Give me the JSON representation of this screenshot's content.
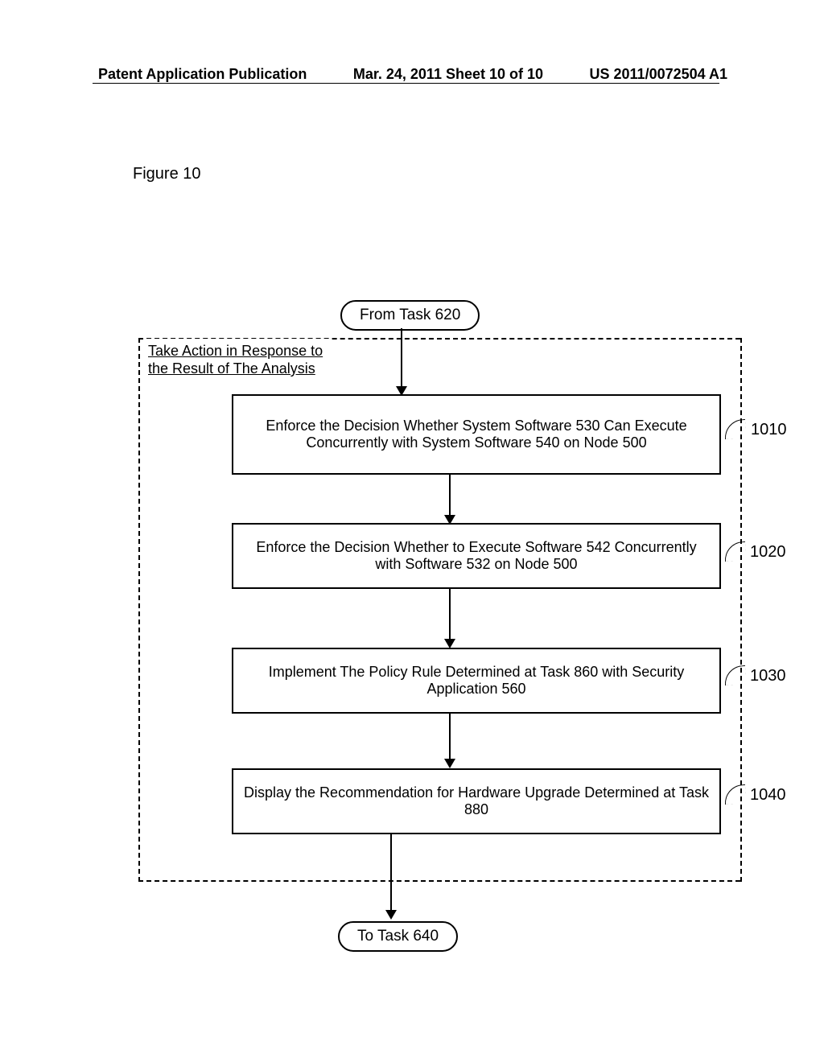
{
  "header": {
    "left": "Patent Application Publication",
    "center": "Mar. 24, 2011  Sheet 10 of 10",
    "right": "US 2011/0072504 A1"
  },
  "figure_label": "Figure 10",
  "terminals": {
    "from": "From Task 620",
    "to": "To Task 640"
  },
  "dashed_title_line1": "Take Action in Response to",
  "dashed_title_line2": "the Result of The Analysis",
  "boxes": {
    "b1": "Enforce the Decision Whether System Software 530 Can Execute Concurrently with System Software 540 on Node 500",
    "b2": "Enforce the Decision Whether to Execute Software 542 Concurrently with Software 532 on Node 500",
    "b3": "Implement The Policy Rule Determined at Task 860 with Security Application 560",
    "b4": "Display the Recommendation for Hardware Upgrade Determined at Task 880"
  },
  "refs": {
    "r1": "1010",
    "r2": "1020",
    "r3": "1030",
    "r4": "1040"
  }
}
